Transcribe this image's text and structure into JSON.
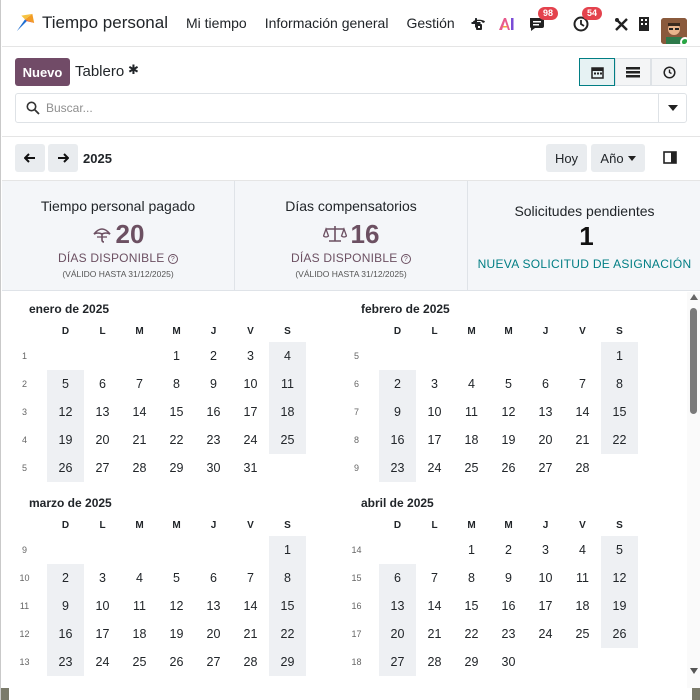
{
  "app": {
    "title": "Tiempo personal",
    "logo_icon": "time-off-logo-icon"
  },
  "menu": [
    {
      "label": "Mi tiempo"
    },
    {
      "label": "Información general"
    },
    {
      "label": "Gestión"
    }
  ],
  "systray": {
    "messages_count": "98",
    "activities_count": "54"
  },
  "control": {
    "new_label": "Nuevo",
    "breadcrumb": "Tablero",
    "search_placeholder": "Buscar..."
  },
  "date_nav": {
    "year": "2025",
    "today_label": "Hoy",
    "scale_label": "Año"
  },
  "summary": {
    "paid": {
      "title": "Tiempo personal pagado",
      "count": "20",
      "status": "DÍAS DISPONIBLE",
      "valid": "(VÁLIDO HASTA 31/12/2025)",
      "icon": "umbrella-icon"
    },
    "comp": {
      "title": "Días compensatorios",
      "count": "16",
      "status": "DÍAS DISPONIBLE",
      "valid": "(VÁLIDO HASTA 31/12/2025)",
      "icon": "scale-icon"
    },
    "pending": {
      "title": "Solicitudes pendientes",
      "count": "1",
      "action": "NUEVA SOLICITUD DE ASIGNACIÓN"
    }
  },
  "weekday_headers": [
    "D",
    "L",
    "M",
    "M",
    "J",
    "V",
    "S"
  ],
  "months": [
    {
      "title": "enero de 2025",
      "weeks": [
        {
          "n": "1",
          "days": [
            "",
            "",
            "",
            "1",
            "2",
            "3",
            "4"
          ]
        },
        {
          "n": "2",
          "days": [
            "5",
            "6",
            "7",
            "8",
            "9",
            "10",
            "11"
          ]
        },
        {
          "n": "3",
          "days": [
            "12",
            "13",
            "14",
            "15",
            "16",
            "17",
            "18"
          ]
        },
        {
          "n": "4",
          "days": [
            "19",
            "20",
            "21",
            "22",
            "23",
            "24",
            "25"
          ]
        },
        {
          "n": "5",
          "days": [
            "26",
            "27",
            "28",
            "29",
            "30",
            "31",
            ""
          ]
        }
      ]
    },
    {
      "title": "febrero de 2025",
      "weeks": [
        {
          "n": "5",
          "days": [
            "",
            "",
            "",
            "",
            "",
            "",
            "1"
          ]
        },
        {
          "n": "6",
          "days": [
            "2",
            "3",
            "4",
            "5",
            "6",
            "7",
            "8"
          ]
        },
        {
          "n": "7",
          "days": [
            "9",
            "10",
            "11",
            "12",
            "13",
            "14",
            "15"
          ]
        },
        {
          "n": "8",
          "days": [
            "16",
            "17",
            "18",
            "19",
            "20",
            "21",
            "22"
          ]
        },
        {
          "n": "9",
          "days": [
            "23",
            "24",
            "25",
            "26",
            "27",
            "28",
            ""
          ]
        }
      ]
    },
    {
      "title": "marzo de 2025",
      "weeks": [
        {
          "n": "9",
          "days": [
            "",
            "",
            "",
            "",
            "",
            "",
            "1"
          ]
        },
        {
          "n": "10",
          "days": [
            "2",
            "3",
            "4",
            "5",
            "6",
            "7",
            "8"
          ]
        },
        {
          "n": "11",
          "days": [
            "9",
            "10",
            "11",
            "12",
            "13",
            "14",
            "15"
          ]
        },
        {
          "n": "12",
          "days": [
            "16",
            "17",
            "18",
            "19",
            "20",
            "21",
            "22"
          ]
        },
        {
          "n": "13",
          "days": [
            "23",
            "24",
            "25",
            "26",
            "27",
            "28",
            "29"
          ]
        }
      ]
    },
    {
      "title": "abril de 2025",
      "weeks": [
        {
          "n": "14",
          "days": [
            "",
            "",
            "1",
            "2",
            "3",
            "4",
            "5"
          ]
        },
        {
          "n": "15",
          "days": [
            "6",
            "7",
            "8",
            "9",
            "10",
            "11",
            "12"
          ]
        },
        {
          "n": "16",
          "days": [
            "13",
            "14",
            "15",
            "16",
            "17",
            "18",
            "19"
          ]
        },
        {
          "n": "17",
          "days": [
            "20",
            "21",
            "22",
            "23",
            "24",
            "25",
            "26"
          ]
        },
        {
          "n": "18",
          "days": [
            "27",
            "28",
            "29",
            "30",
            "",
            "",
            ""
          ]
        }
      ]
    }
  ],
  "colors": {
    "brand": "#714b67",
    "accent": "#017e84",
    "weekend_bg": "#eef0f3",
    "badge": "#e4424d"
  }
}
